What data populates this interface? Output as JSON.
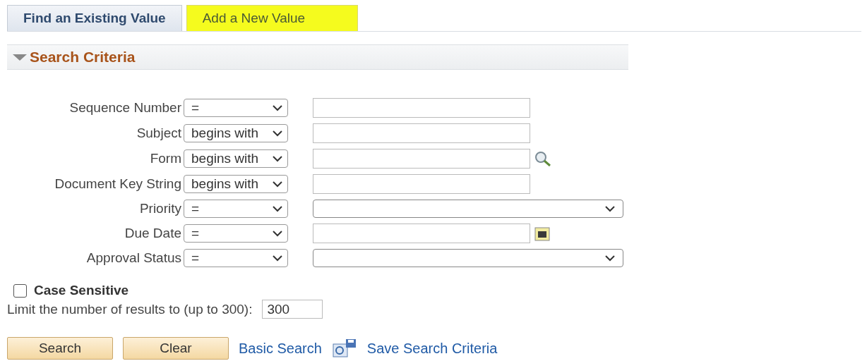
{
  "tabs": [
    {
      "label": "Find an Existing Value",
      "selected": true,
      "highlighted": false
    },
    {
      "label": "Add a New Value",
      "selected": false,
      "highlighted": true
    }
  ],
  "section": {
    "title": "Search Criteria",
    "expanded": true
  },
  "criteria": [
    {
      "label": "Sequence Number",
      "operator": "=",
      "kind": "text"
    },
    {
      "label": "Subject",
      "operator": "begins with",
      "kind": "text"
    },
    {
      "label": "Form",
      "operator": "begins with",
      "kind": "lookup"
    },
    {
      "label": "Document Key String",
      "operator": "begins with",
      "kind": "text"
    },
    {
      "label": "Priority",
      "operator": "=",
      "kind": "select"
    },
    {
      "label": "Due Date",
      "operator": "=",
      "kind": "date"
    },
    {
      "label": "Approval Status",
      "operator": "=",
      "kind": "select"
    }
  ],
  "case_sensitive": {
    "label": "Case Sensitive",
    "checked": false
  },
  "limit": {
    "label": "Limit the number of results to (up to 300):",
    "value": "300"
  },
  "buttons": [
    "Search",
    "Clear"
  ],
  "links": [
    {
      "label": "Basic Search",
      "kind": "plain"
    },
    {
      "label": "Save Search Criteria",
      "kind": "save"
    }
  ]
}
